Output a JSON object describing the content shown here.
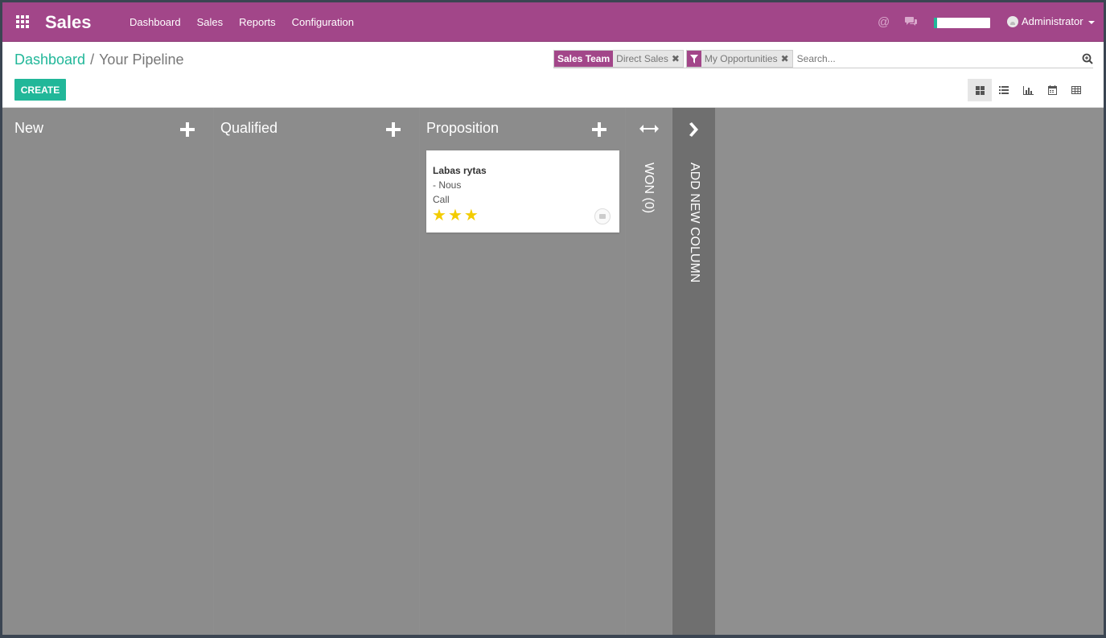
{
  "app": {
    "brand": "Sales"
  },
  "topbar": {
    "menu": [
      {
        "label": "Dashboard"
      },
      {
        "label": "Sales"
      },
      {
        "label": "Reports"
      },
      {
        "label": "Configuration"
      }
    ],
    "user": "Administrator",
    "progress_fraction": 0.05,
    "colors": {
      "bar": "#a24689",
      "accent": "#21b799"
    }
  },
  "breadcrumb": {
    "parent": "Dashboard",
    "separator": "/",
    "current": "Your Pipeline"
  },
  "toolbar": {
    "create_label": "CREATE"
  },
  "search": {
    "facets": [
      {
        "label": "Sales Team",
        "value": "Direct Sales"
      },
      {
        "label": "filter-icon",
        "value": "My Opportunities"
      }
    ],
    "placeholder": "Search..."
  },
  "views": [
    "kanban-icon",
    "list-icon",
    "graph-icon",
    "calendar-icon",
    "pivot-icon"
  ],
  "kanban": {
    "columns": [
      {
        "title": "New"
      },
      {
        "title": "Qualified"
      },
      {
        "title": "Proposition"
      }
    ],
    "card": {
      "title": "Labas rytas",
      "partner": "- Nous",
      "activity": "Call",
      "stars": 3
    },
    "folded_column": "WON (0)",
    "add_column": "ADD NEW COLUMN"
  }
}
